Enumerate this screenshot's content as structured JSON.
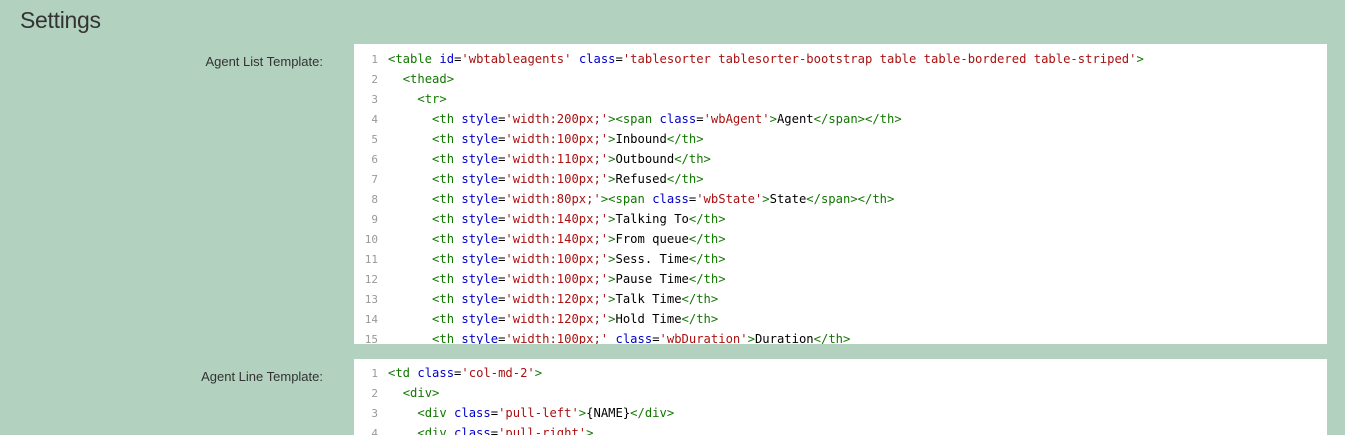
{
  "page": {
    "title": "Settings"
  },
  "agent_list": {
    "label": "Agent List Template:",
    "lines": [
      {
        "n": "1",
        "parts": [
          [
            "tag",
            "<table "
          ],
          [
            "attr",
            "id"
          ],
          [
            "text",
            "="
          ],
          [
            "str",
            "'wbtableagents'"
          ],
          [
            "text",
            " "
          ],
          [
            "attr",
            "class"
          ],
          [
            "text",
            "="
          ],
          [
            "str",
            "'tablesorter tablesorter-bootstrap table table-bordered table-striped'"
          ],
          [
            "tag",
            ">"
          ]
        ]
      },
      {
        "n": "2",
        "parts": [
          [
            "text",
            "  "
          ],
          [
            "tag",
            "<thead>"
          ]
        ]
      },
      {
        "n": "3",
        "parts": [
          [
            "text",
            "    "
          ],
          [
            "tag",
            "<tr>"
          ]
        ]
      },
      {
        "n": "4",
        "parts": [
          [
            "text",
            "      "
          ],
          [
            "tag",
            "<th "
          ],
          [
            "attr",
            "style"
          ],
          [
            "text",
            "="
          ],
          [
            "str",
            "'width:200px;'"
          ],
          [
            "tag",
            "><span "
          ],
          [
            "attr",
            "class"
          ],
          [
            "text",
            "="
          ],
          [
            "str",
            "'wbAgent'"
          ],
          [
            "tag",
            ">"
          ],
          [
            "text",
            "Agent"
          ],
          [
            "tag",
            "</span></th>"
          ]
        ]
      },
      {
        "n": "5",
        "parts": [
          [
            "text",
            "      "
          ],
          [
            "tag",
            "<th "
          ],
          [
            "attr",
            "style"
          ],
          [
            "text",
            "="
          ],
          [
            "str",
            "'width:100px;'"
          ],
          [
            "tag",
            ">"
          ],
          [
            "text",
            "Inbound"
          ],
          [
            "tag",
            "</th>"
          ]
        ]
      },
      {
        "n": "6",
        "parts": [
          [
            "text",
            "      "
          ],
          [
            "tag",
            "<th "
          ],
          [
            "attr",
            "style"
          ],
          [
            "text",
            "="
          ],
          [
            "str",
            "'width:110px;'"
          ],
          [
            "tag",
            ">"
          ],
          [
            "text",
            "Outbound"
          ],
          [
            "tag",
            "</th>"
          ]
        ]
      },
      {
        "n": "7",
        "parts": [
          [
            "text",
            "      "
          ],
          [
            "tag",
            "<th "
          ],
          [
            "attr",
            "style"
          ],
          [
            "text",
            "="
          ],
          [
            "str",
            "'width:100px;'"
          ],
          [
            "tag",
            ">"
          ],
          [
            "text",
            "Refused"
          ],
          [
            "tag",
            "</th>"
          ]
        ]
      },
      {
        "n": "8",
        "parts": [
          [
            "text",
            "      "
          ],
          [
            "tag",
            "<th "
          ],
          [
            "attr",
            "style"
          ],
          [
            "text",
            "="
          ],
          [
            "str",
            "'width:80px;'"
          ],
          [
            "tag",
            "><span "
          ],
          [
            "attr",
            "class"
          ],
          [
            "text",
            "="
          ],
          [
            "str",
            "'wbState'"
          ],
          [
            "tag",
            ">"
          ],
          [
            "text",
            "State"
          ],
          [
            "tag",
            "</span></th>"
          ]
        ]
      },
      {
        "n": "9",
        "parts": [
          [
            "text",
            "      "
          ],
          [
            "tag",
            "<th "
          ],
          [
            "attr",
            "style"
          ],
          [
            "text",
            "="
          ],
          [
            "str",
            "'width:140px;'"
          ],
          [
            "tag",
            ">"
          ],
          [
            "text",
            "Talking To"
          ],
          [
            "tag",
            "</th>"
          ]
        ]
      },
      {
        "n": "10",
        "parts": [
          [
            "text",
            "      "
          ],
          [
            "tag",
            "<th "
          ],
          [
            "attr",
            "style"
          ],
          [
            "text",
            "="
          ],
          [
            "str",
            "'width:140px;'"
          ],
          [
            "tag",
            ">"
          ],
          [
            "text",
            "From queue"
          ],
          [
            "tag",
            "</th>"
          ]
        ]
      },
      {
        "n": "11",
        "parts": [
          [
            "text",
            "      "
          ],
          [
            "tag",
            "<th "
          ],
          [
            "attr",
            "style"
          ],
          [
            "text",
            "="
          ],
          [
            "str",
            "'width:100px;'"
          ],
          [
            "tag",
            ">"
          ],
          [
            "text",
            "Sess. Time"
          ],
          [
            "tag",
            "</th>"
          ]
        ]
      },
      {
        "n": "12",
        "parts": [
          [
            "text",
            "      "
          ],
          [
            "tag",
            "<th "
          ],
          [
            "attr",
            "style"
          ],
          [
            "text",
            "="
          ],
          [
            "str",
            "'width:100px;'"
          ],
          [
            "tag",
            ">"
          ],
          [
            "text",
            "Pause Time"
          ],
          [
            "tag",
            "</th>"
          ]
        ]
      },
      {
        "n": "13",
        "parts": [
          [
            "text",
            "      "
          ],
          [
            "tag",
            "<th "
          ],
          [
            "attr",
            "style"
          ],
          [
            "text",
            "="
          ],
          [
            "str",
            "'width:120px;'"
          ],
          [
            "tag",
            ">"
          ],
          [
            "text",
            "Talk Time"
          ],
          [
            "tag",
            "</th>"
          ]
        ]
      },
      {
        "n": "14",
        "parts": [
          [
            "text",
            "      "
          ],
          [
            "tag",
            "<th "
          ],
          [
            "attr",
            "style"
          ],
          [
            "text",
            "="
          ],
          [
            "str",
            "'width:120px;'"
          ],
          [
            "tag",
            ">"
          ],
          [
            "text",
            "Hold Time"
          ],
          [
            "tag",
            "</th>"
          ]
        ]
      },
      {
        "n": "15",
        "parts": [
          [
            "text",
            "      "
          ],
          [
            "tag",
            "<th "
          ],
          [
            "attr",
            "style"
          ],
          [
            "text",
            "="
          ],
          [
            "str",
            "'width:100px;'"
          ],
          [
            "text",
            " "
          ],
          [
            "attr",
            "class"
          ],
          [
            "text",
            "="
          ],
          [
            "str",
            "'wbDuration'"
          ],
          [
            "tag",
            ">"
          ],
          [
            "text",
            "Duration"
          ],
          [
            "tag",
            "</th>"
          ]
        ]
      }
    ]
  },
  "agent_line": {
    "label": "Agent Line Template:",
    "lines": [
      {
        "n": "1",
        "parts": [
          [
            "tag",
            "<td "
          ],
          [
            "attr",
            "class"
          ],
          [
            "text",
            "="
          ],
          [
            "str",
            "'col-md-2'"
          ],
          [
            "tag",
            ">"
          ]
        ]
      },
      {
        "n": "2",
        "parts": [
          [
            "text",
            "  "
          ],
          [
            "tag",
            "<div>"
          ]
        ]
      },
      {
        "n": "3",
        "parts": [
          [
            "text",
            "    "
          ],
          [
            "tag",
            "<div "
          ],
          [
            "attr",
            "class"
          ],
          [
            "text",
            "="
          ],
          [
            "str",
            "'pull-left'"
          ],
          [
            "tag",
            ">"
          ],
          [
            "text",
            "{NAME}"
          ],
          [
            "tag",
            "</div>"
          ]
        ]
      },
      {
        "n": "4",
        "parts": [
          [
            "text",
            "    "
          ],
          [
            "tag",
            "<div "
          ],
          [
            "attr",
            "class"
          ],
          [
            "text",
            "="
          ],
          [
            "str",
            "'pull-right'"
          ],
          [
            "tag",
            ">"
          ]
        ]
      }
    ]
  }
}
